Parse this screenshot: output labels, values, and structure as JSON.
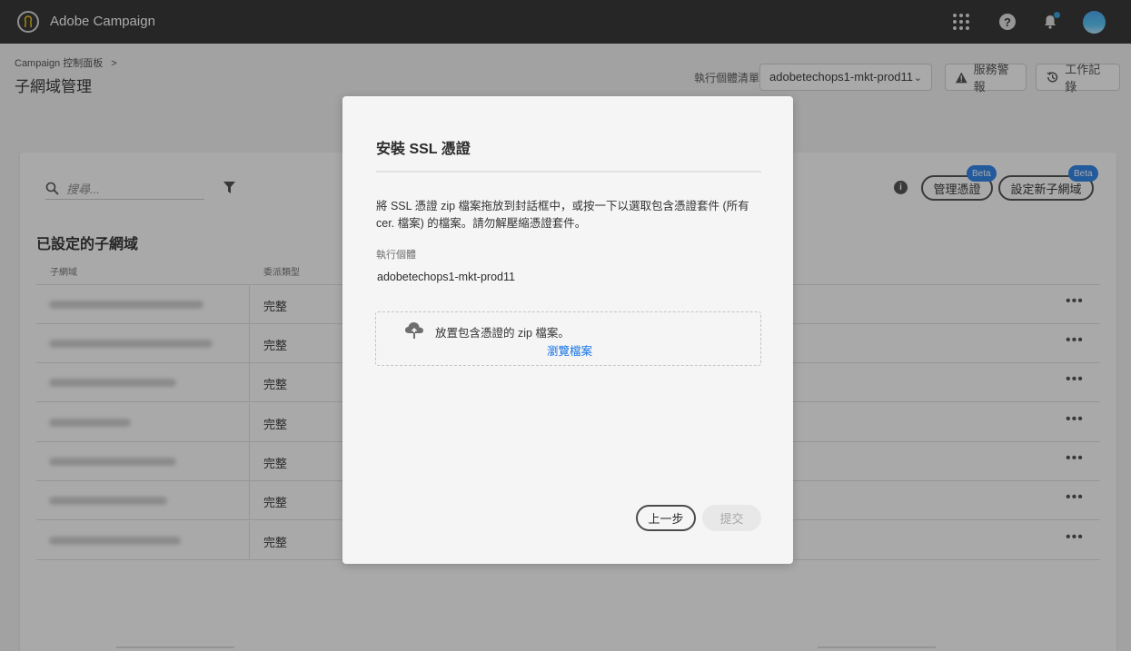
{
  "app": {
    "title": "Adobe Campaign"
  },
  "header": {
    "breadcrumb": "Campaign 控制面板",
    "breadcrumb_sep": ">",
    "page_title": "子網域管理",
    "instance_label": "執行個體清單",
    "instance_value": "adobetechops1-mkt-prod11",
    "service_alerts": "服務警報",
    "job_logs": "工作記錄"
  },
  "toolbar": {
    "search_placeholder": "搜尋...",
    "manage_certs": "管理憑證",
    "setup_subdomain": "設定新子網域",
    "beta": "Beta"
  },
  "table": {
    "title": "已設定的子網域",
    "columns": [
      "子網域",
      "委派類型"
    ],
    "rows": [
      {
        "type": "完整"
      },
      {
        "type": "完整"
      },
      {
        "type": "完整"
      },
      {
        "type": "完整"
      },
      {
        "type": "完整"
      },
      {
        "type": "完整"
      },
      {
        "type": "完整"
      }
    ],
    "more": "•••"
  },
  "dialog": {
    "title": "安裝 SSL 憑證",
    "description": "將 SSL 憑證 zip 檔案拖放到封話框中，或按一下以選取包含憑證套件 (所有 cer. 檔案) 的檔案。請勿解壓縮憑證套件。",
    "instance_label": "執行個體",
    "instance_value": "adobetechops1-mkt-prod11",
    "drop_text": "放置包含憑證的 zip 檔案。",
    "browse": "瀏覽檔案",
    "back": "上一步",
    "submit": "提交"
  },
  "icons": [
    "adobe-campaign-logo-icon",
    "apps-grid-icon",
    "help-icon",
    "bell-icon",
    "avatar",
    "chevron-down-icon",
    "warning-icon",
    "history-icon",
    "search-icon",
    "filter-icon",
    "info-icon",
    "more-icon",
    "cloud-upload-icon"
  ]
}
